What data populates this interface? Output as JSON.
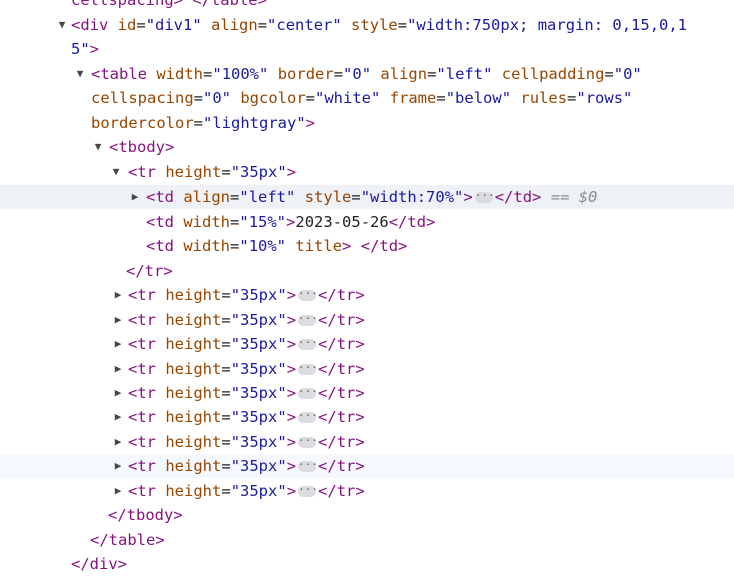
{
  "tree": {
    "line_top_cut": "cellspacing> </table>",
    "div_open": "<div id=\"div1\" align=\"center\" style=\"width:750px; margin: 0,15,0,1",
    "div_open_cont": "5\">",
    "table_open_1": "<table width=\"100%\" border=\"0\" align=\"left\" cellpadding=\"0\"",
    "table_open_2": "cellspacing=\"0\" bgcolor=\"white\" frame=\"below\" rules=\"rows\"",
    "table_open_3": "bordercolor=\"lightgray\">",
    "tbody_open": "<tbody>",
    "tr_open": "<tr height=\"35px\">",
    "td_open": "<td align=\"left\" style=\"width:70%\">",
    "td_close": "</td>",
    "selected_marker": "== $0",
    "td2_open": "<td width=\"15%\">",
    "td2_text": "2023-05-26",
    "td3_open": "<td width=\"10%\" title>",
    "td3_text": " ",
    "tr_close": "</tr>",
    "collapsed_tr_open": "<tr height=\"35px\">",
    "collapsed_tr_close": "</tr>",
    "ellipsis": "···",
    "tbody_close": "</tbody>",
    "table_close": "</table>",
    "div_close": "</div>"
  },
  "colors": {
    "tag": "#881280",
    "attr_name": "#994500",
    "attr_value": "#1a1aa6",
    "selected_row": "#eef1f5",
    "hover_row": "#f5f8fe"
  },
  "icons": {
    "expanded": "triangle-down-icon",
    "collapsed": "triangle-right-icon"
  }
}
